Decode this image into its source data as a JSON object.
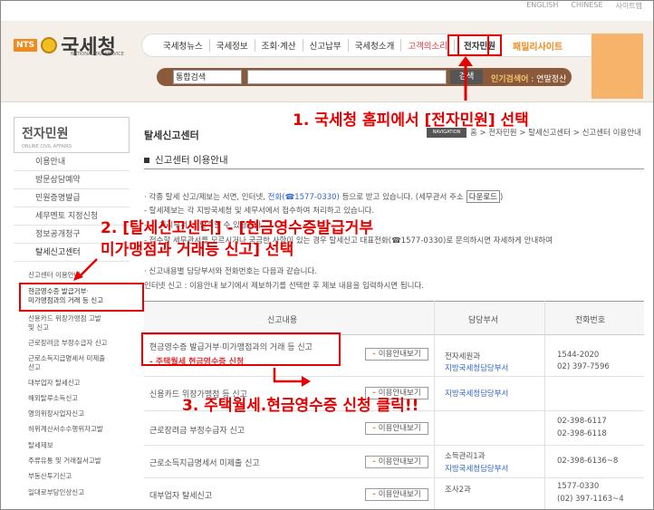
{
  "topbar": {
    "links": [
      "ENGLISH",
      "CHINESE",
      "사이트맵"
    ]
  },
  "logo": {
    "badge": "NTS",
    "title": "국세청",
    "subtitle": "NATIONAL TAX SERVICE"
  },
  "gnb": {
    "items": [
      "국세청뉴스",
      "국세정보",
      "조회·계산",
      "신고납부",
      "국세청소개",
      "고객의소리"
    ],
    "highlighted": "전자민원",
    "family": "패밀리사이트"
  },
  "search": {
    "select_value": "통합검색",
    "input_value": "",
    "button_label": "검색",
    "popular_label": "인기검색어",
    "popular_value": "연말정산"
  },
  "sidebar": {
    "title": "전자민원",
    "title_en": "ONLINE CIVIL AFFAIRS",
    "items": [
      "이용안내",
      "방문상담예약",
      "민원증명발급",
      "세무멘토 지정신청",
      "정보공개청구",
      "탈세신고센터"
    ],
    "sub_items": [
      "신고센터 이용안내",
      "현금영수증 발급거부·",
      "미가맹점과의 거래 등 신고",
      "신용카드 위장가맹점 고발",
      "및 신고",
      "근로장려금 부정수급자 신고",
      "근로소득지급명세서 미제출",
      "신고",
      "대부업자 탈세신고",
      "해외탈루소득신고",
      "명의위장사업자신고",
      "허위계산서수수행위자고발",
      "탈세제보",
      "주류유통 및 거래질서고발",
      "부동산투기신고",
      "일대로부당인상신고"
    ]
  },
  "main": {
    "title": "탈세신고센터",
    "nav_badge": "NAVIGATION",
    "breadcrumb": "홈 > 전자민원 > 탈세신고센터 > 신고센터 이용안내",
    "section_title": "신고센터 이용안내",
    "para1_a": "· 각종 탈세 신고/제보는 서면, 인터넷, ",
    "para1_link": "전화(☎1577-0330)",
    "para1_b": " 등으로 받고 있습니다. (세무관서 주소",
    "para1_download": "다운로드",
    "para1_c": ")",
    "para2": "- 탈세제보는 각 지방국세청 및 세무서에서 접수하여 처리하고 있습니다.",
    "para3": "- ... 처리부서 ... 단축할 수 있습니다.",
    "para4": "- 접수할 세무관서를 모르시거나 궁금한 사항이 있는 경우 탈세신고 대표전화(☎1577-0330)로 문의하시면 자세하게 안내하여",
    "para5": "· 신고내용별 담당부서와 전화번호는 다음과 같습니다.",
    "para6": "인터넷 신고 : 이용안내 보기에서 제보하기를 선택한 후 제보 내용을 입력하시면 됩니다."
  },
  "table": {
    "headers": [
      "신고내용",
      "담당부서",
      "전화번호"
    ],
    "button_label": "이용안내보기",
    "rows": [
      {
        "title": "현금영수증 발급거부·미가맹점과의 거래 등 신고",
        "sub": "- 주택월세 현금영수증 신청",
        "dept1": "전자세원과",
        "dept2": "지방국세청담당부서",
        "phone1": "1544-2020",
        "phone2": "02) 397-7596"
      },
      {
        "title": "신용카드 위장가맹점 등 신고",
        "sub": "",
        "dept1": "",
        "dept2": "지방국세청담당부서",
        "phone1": "",
        "phone2": ""
      },
      {
        "title": "근로장려금 부정수급자 신고",
        "sub": "",
        "dept1": "",
        "dept2": "",
        "phone1": "02-398-6117",
        "phone2": "02-398-6118"
      },
      {
        "title": "근로소득지급명세서 미제출 신고",
        "sub": "",
        "dept1": "소득관리1과",
        "dept2": "지방국세청담당부서",
        "phone1": "02-398-6136~8",
        "phone2": ""
      },
      {
        "title": "대부업자 탈세신고",
        "sub": "",
        "dept1": "조사2과",
        "dept2": "",
        "phone1": "1577-0330",
        "phone2": "(02) 397-1163~4"
      }
    ]
  },
  "annotations": {
    "step1": "1. 국세청 홈피에서 [전자민원] 선택",
    "step2_line1": "2. [탈세신고센터] - [현금영수증발급거부",
    "step2_line2": "미가맹점과 거래등 신고] 선택",
    "step3": "3. 주택월세.현금영수증 신청 클릭!!"
  },
  "colors": {
    "annotation_red": "#e60000",
    "link_blue": "#3366cc",
    "accent_orange": "#f08a1c",
    "header_bg": "#f4efe8",
    "search_brown": "#8a5a3a"
  }
}
